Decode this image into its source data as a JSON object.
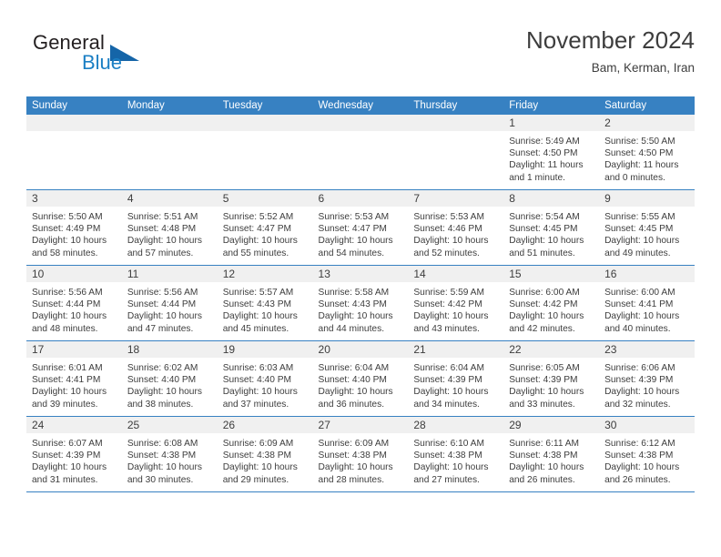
{
  "logo": {
    "word1": "General",
    "word2": "Blue",
    "triangle_color": "#1565a8",
    "blue_color": "#1b7fc4"
  },
  "header": {
    "title": "November 2024",
    "subtitle": "Bam, Kerman, Iran"
  },
  "theme": {
    "header_blue": "#3781c2",
    "daynum_band": "#f0f0f0",
    "text": "#3d3d3d"
  },
  "weekday_headers": [
    "Sunday",
    "Monday",
    "Tuesday",
    "Wednesday",
    "Thursday",
    "Friday",
    "Saturday"
  ],
  "labels": {
    "sunrise_prefix": "Sunrise:",
    "sunset_prefix": "Sunset:",
    "daylight_prefix": "Daylight:"
  },
  "weeks": [
    [
      {
        "blank": true
      },
      {
        "blank": true
      },
      {
        "blank": true
      },
      {
        "blank": true
      },
      {
        "blank": true
      },
      {
        "day": "1",
        "sunrise": "Sunrise: 5:49 AM",
        "sunset": "Sunset: 4:50 PM",
        "daylight1": "Daylight: 11 hours",
        "daylight2": "and 1 minute."
      },
      {
        "day": "2",
        "sunrise": "Sunrise: 5:50 AM",
        "sunset": "Sunset: 4:50 PM",
        "daylight1": "Daylight: 11 hours",
        "daylight2": "and 0 minutes."
      }
    ],
    [
      {
        "day": "3",
        "sunrise": "Sunrise: 5:50 AM",
        "sunset": "Sunset: 4:49 PM",
        "daylight1": "Daylight: 10 hours",
        "daylight2": "and 58 minutes."
      },
      {
        "day": "4",
        "sunrise": "Sunrise: 5:51 AM",
        "sunset": "Sunset: 4:48 PM",
        "daylight1": "Daylight: 10 hours",
        "daylight2": "and 57 minutes."
      },
      {
        "day": "5",
        "sunrise": "Sunrise: 5:52 AM",
        "sunset": "Sunset: 4:47 PM",
        "daylight1": "Daylight: 10 hours",
        "daylight2": "and 55 minutes."
      },
      {
        "day": "6",
        "sunrise": "Sunrise: 5:53 AM",
        "sunset": "Sunset: 4:47 PM",
        "daylight1": "Daylight: 10 hours",
        "daylight2": "and 54 minutes."
      },
      {
        "day": "7",
        "sunrise": "Sunrise: 5:53 AM",
        "sunset": "Sunset: 4:46 PM",
        "daylight1": "Daylight: 10 hours",
        "daylight2": "and 52 minutes."
      },
      {
        "day": "8",
        "sunrise": "Sunrise: 5:54 AM",
        "sunset": "Sunset: 4:45 PM",
        "daylight1": "Daylight: 10 hours",
        "daylight2": "and 51 minutes."
      },
      {
        "day": "9",
        "sunrise": "Sunrise: 5:55 AM",
        "sunset": "Sunset: 4:45 PM",
        "daylight1": "Daylight: 10 hours",
        "daylight2": "and 49 minutes."
      }
    ],
    [
      {
        "day": "10",
        "sunrise": "Sunrise: 5:56 AM",
        "sunset": "Sunset: 4:44 PM",
        "daylight1": "Daylight: 10 hours",
        "daylight2": "and 48 minutes."
      },
      {
        "day": "11",
        "sunrise": "Sunrise: 5:56 AM",
        "sunset": "Sunset: 4:44 PM",
        "daylight1": "Daylight: 10 hours",
        "daylight2": "and 47 minutes."
      },
      {
        "day": "12",
        "sunrise": "Sunrise: 5:57 AM",
        "sunset": "Sunset: 4:43 PM",
        "daylight1": "Daylight: 10 hours",
        "daylight2": "and 45 minutes."
      },
      {
        "day": "13",
        "sunrise": "Sunrise: 5:58 AM",
        "sunset": "Sunset: 4:43 PM",
        "daylight1": "Daylight: 10 hours",
        "daylight2": "and 44 minutes."
      },
      {
        "day": "14",
        "sunrise": "Sunrise: 5:59 AM",
        "sunset": "Sunset: 4:42 PM",
        "daylight1": "Daylight: 10 hours",
        "daylight2": "and 43 minutes."
      },
      {
        "day": "15",
        "sunrise": "Sunrise: 6:00 AM",
        "sunset": "Sunset: 4:42 PM",
        "daylight1": "Daylight: 10 hours",
        "daylight2": "and 42 minutes."
      },
      {
        "day": "16",
        "sunrise": "Sunrise: 6:00 AM",
        "sunset": "Sunset: 4:41 PM",
        "daylight1": "Daylight: 10 hours",
        "daylight2": "and 40 minutes."
      }
    ],
    [
      {
        "day": "17",
        "sunrise": "Sunrise: 6:01 AM",
        "sunset": "Sunset: 4:41 PM",
        "daylight1": "Daylight: 10 hours",
        "daylight2": "and 39 minutes."
      },
      {
        "day": "18",
        "sunrise": "Sunrise: 6:02 AM",
        "sunset": "Sunset: 4:40 PM",
        "daylight1": "Daylight: 10 hours",
        "daylight2": "and 38 minutes."
      },
      {
        "day": "19",
        "sunrise": "Sunrise: 6:03 AM",
        "sunset": "Sunset: 4:40 PM",
        "daylight1": "Daylight: 10 hours",
        "daylight2": "and 37 minutes."
      },
      {
        "day": "20",
        "sunrise": "Sunrise: 6:04 AM",
        "sunset": "Sunset: 4:40 PM",
        "daylight1": "Daylight: 10 hours",
        "daylight2": "and 36 minutes."
      },
      {
        "day": "21",
        "sunrise": "Sunrise: 6:04 AM",
        "sunset": "Sunset: 4:39 PM",
        "daylight1": "Daylight: 10 hours",
        "daylight2": "and 34 minutes."
      },
      {
        "day": "22",
        "sunrise": "Sunrise: 6:05 AM",
        "sunset": "Sunset: 4:39 PM",
        "daylight1": "Daylight: 10 hours",
        "daylight2": "and 33 minutes."
      },
      {
        "day": "23",
        "sunrise": "Sunrise: 6:06 AM",
        "sunset": "Sunset: 4:39 PM",
        "daylight1": "Daylight: 10 hours",
        "daylight2": "and 32 minutes."
      }
    ],
    [
      {
        "day": "24",
        "sunrise": "Sunrise: 6:07 AM",
        "sunset": "Sunset: 4:39 PM",
        "daylight1": "Daylight: 10 hours",
        "daylight2": "and 31 minutes."
      },
      {
        "day": "25",
        "sunrise": "Sunrise: 6:08 AM",
        "sunset": "Sunset: 4:38 PM",
        "daylight1": "Daylight: 10 hours",
        "daylight2": "and 30 minutes."
      },
      {
        "day": "26",
        "sunrise": "Sunrise: 6:09 AM",
        "sunset": "Sunset: 4:38 PM",
        "daylight1": "Daylight: 10 hours",
        "daylight2": "and 29 minutes."
      },
      {
        "day": "27",
        "sunrise": "Sunrise: 6:09 AM",
        "sunset": "Sunset: 4:38 PM",
        "daylight1": "Daylight: 10 hours",
        "daylight2": "and 28 minutes."
      },
      {
        "day": "28",
        "sunrise": "Sunrise: 6:10 AM",
        "sunset": "Sunset: 4:38 PM",
        "daylight1": "Daylight: 10 hours",
        "daylight2": "and 27 minutes."
      },
      {
        "day": "29",
        "sunrise": "Sunrise: 6:11 AM",
        "sunset": "Sunset: 4:38 PM",
        "daylight1": "Daylight: 10 hours",
        "daylight2": "and 26 minutes."
      },
      {
        "day": "30",
        "sunrise": "Sunrise: 6:12 AM",
        "sunset": "Sunset: 4:38 PM",
        "daylight1": "Daylight: 10 hours",
        "daylight2": "and 26 minutes."
      }
    ]
  ]
}
